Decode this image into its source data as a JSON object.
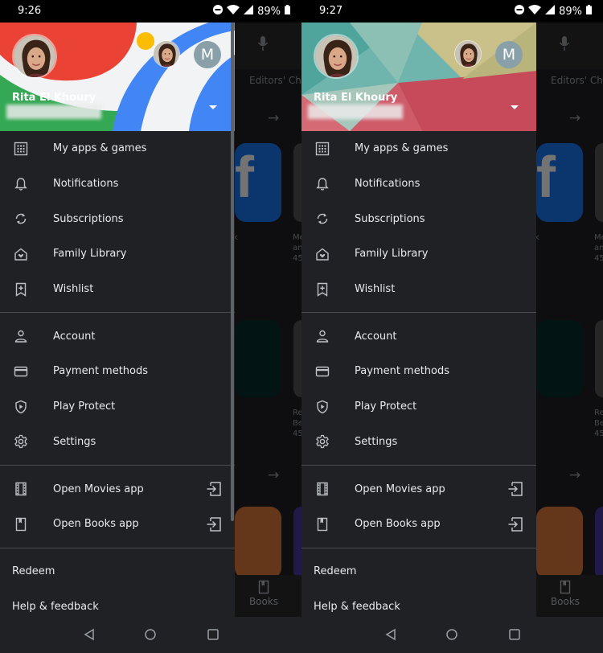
{
  "colors": {
    "drawer_bg": "#202124",
    "text": "#e8eaed",
    "icon": "#bdc1c6"
  },
  "phones": [
    {
      "status": {
        "time": "9:26",
        "battery": "89%"
      },
      "header_theme": "material-shapes",
      "account": {
        "name": "Rita El Khoury",
        "alt_initial": "M"
      },
      "menu_group1": [
        "My apps & games",
        "Notifications",
        "Subscriptions",
        "Family Library",
        "Wishlist"
      ],
      "menu_group2": [
        "Account",
        "Payment methods",
        "Play Protect",
        "Settings"
      ],
      "menu_group3": [
        "Open Movies app",
        "Open Books app"
      ],
      "footer_links": [
        "Redeem",
        "Help & feedback"
      ],
      "background": {
        "tab": "Editors' Ch",
        "books": "Books"
      }
    },
    {
      "status": {
        "time": "9:27",
        "battery": "89%"
      },
      "header_theme": "triangles",
      "account": {
        "name": "Rita El Khoury",
        "alt_initial": "M"
      },
      "menu_group1": [
        "My apps & games",
        "Notifications",
        "Subscriptions",
        "Family Library",
        "Wishlist"
      ],
      "menu_group2": [
        "Account",
        "Payment methods",
        "Play Protect",
        "Settings"
      ],
      "menu_group3": [
        "Open Movies app",
        "Open Books app"
      ],
      "footer_links": [
        "Redeem",
        "Help & feedback"
      ],
      "background": {
        "tab": "Editors' Ch",
        "books": "Books"
      }
    }
  ],
  "icons": {
    "menu_group1": [
      "apps-grid-icon",
      "bell-icon",
      "refresh-icon",
      "family-home-icon",
      "bookmark-plus-icon"
    ],
    "menu_group2": [
      "person-icon",
      "credit-card-icon",
      "shield-play-icon",
      "gear-icon"
    ],
    "menu_group3": [
      "film-icon",
      "book-icon"
    ]
  }
}
